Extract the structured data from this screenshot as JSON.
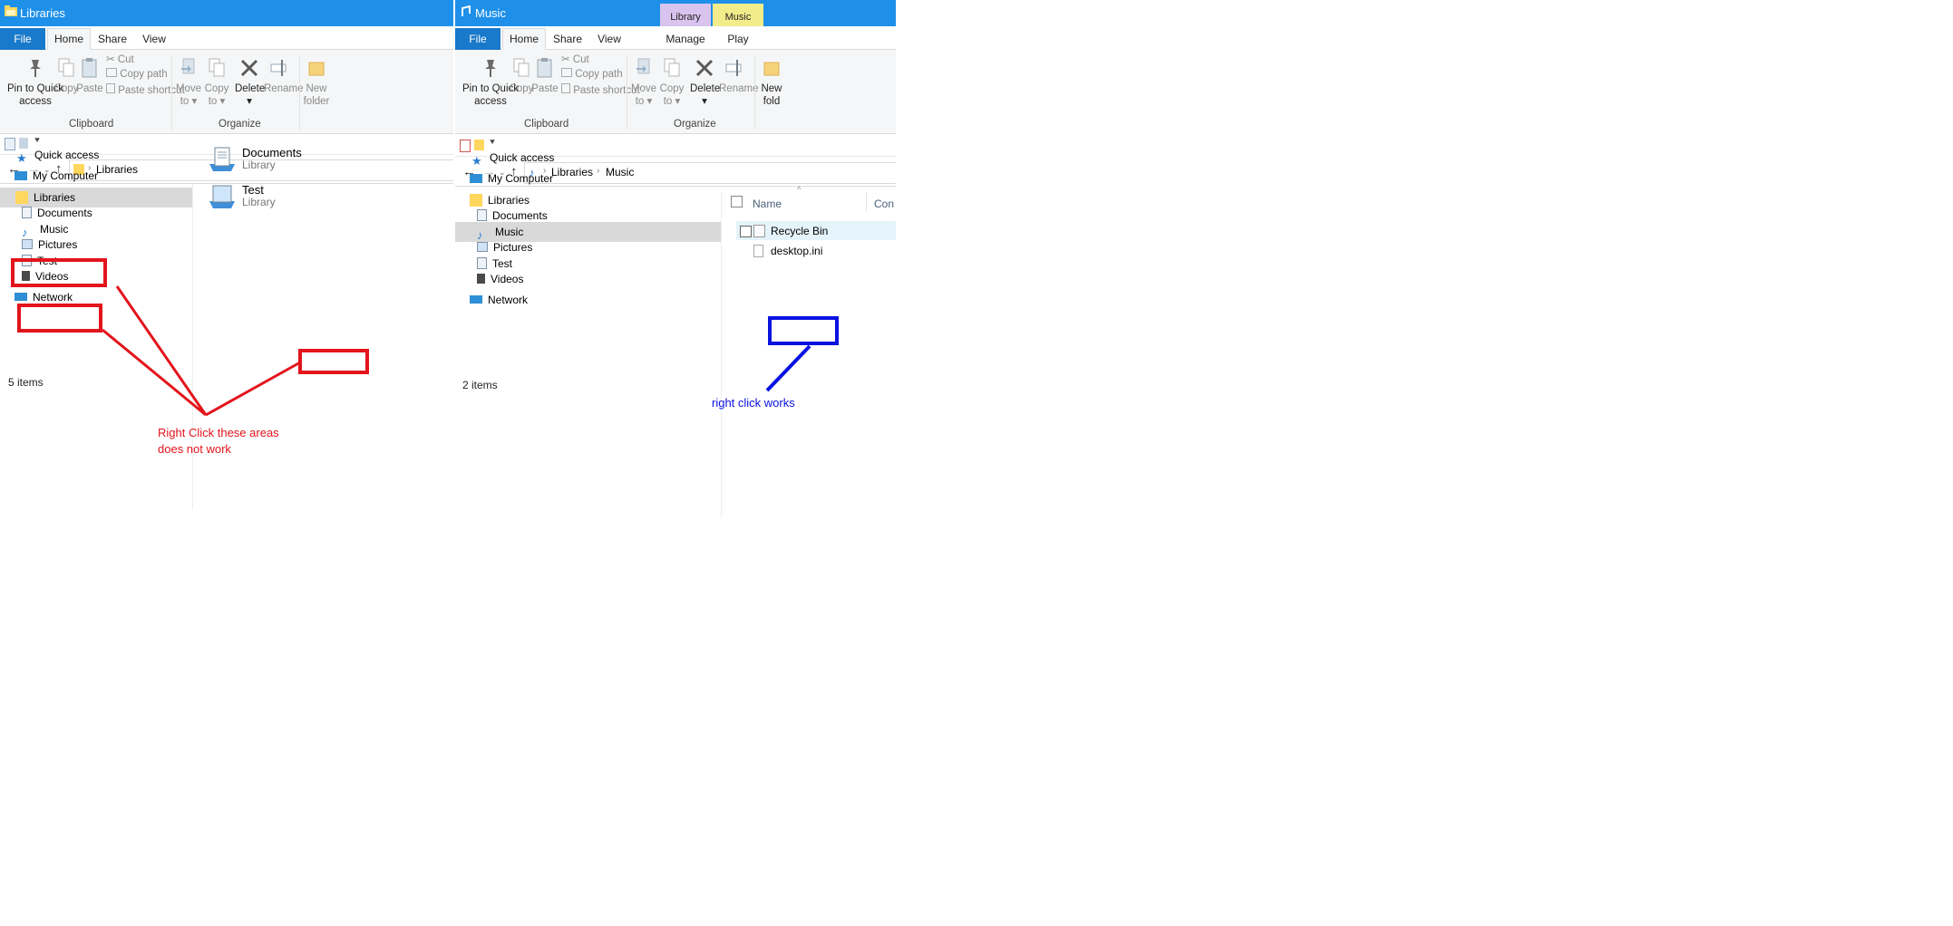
{
  "left": {
    "title": "Libraries",
    "tabs": [
      "File",
      "Home",
      "Share",
      "View"
    ],
    "ribbon": {
      "pin": [
        "Pin to Quick",
        "access"
      ],
      "copy": "Copy",
      "paste": "Paste",
      "cut": "Cut",
      "copy_path": "Copy path",
      "paste_shortcut": "Paste shortcut",
      "move_to": [
        "Move",
        "to ▾"
      ],
      "copy_to": [
        "Copy",
        "to ▾"
      ],
      "delete": "Delete",
      "rename": "Rename",
      "new_folder": [
        "New",
        "folder"
      ],
      "group_clipboard": "Clipboard",
      "group_organize": "Organize"
    },
    "breadcrumb": [
      "Libraries"
    ],
    "nav": [
      "Quick access",
      "My Computer",
      "Libraries",
      "Documents",
      "Music",
      "Pictures",
      "Test",
      "Videos",
      "Network"
    ],
    "tiles": [
      {
        "name": "Documents",
        "type": "Library"
      },
      {
        "name": "Test",
        "type": "Library"
      }
    ],
    "status": "5 items"
  },
  "right": {
    "title": "Music",
    "context_tabs": [
      "Library Tools",
      "Music Tools"
    ],
    "tabs": [
      "File",
      "Home",
      "Share",
      "View",
      "Manage",
      "Play"
    ],
    "ribbon": {
      "pin": [
        "Pin to Quick",
        "access"
      ],
      "copy": "Copy",
      "paste": "Paste",
      "cut": "Cut",
      "copy_path": "Copy path",
      "paste_shortcut": "Paste shortcut",
      "move_to": [
        "Move",
        "to ▾"
      ],
      "copy_to": [
        "Copy",
        "to ▾"
      ],
      "delete": "Delete",
      "rename": "Rename",
      "new_folder": [
        "New",
        "fold"
      ],
      "group_clipboard": "Clipboard",
      "group_organize": "Organize"
    },
    "breadcrumb": [
      "Libraries",
      "Music"
    ],
    "nav": [
      "Quick access",
      "My Computer",
      "Libraries",
      "Documents",
      "Music",
      "Pictures",
      "Test",
      "Videos",
      "Network"
    ],
    "columns": [
      "Name",
      "Con"
    ],
    "files": [
      "Recycle Bin",
      "desktop.ini"
    ],
    "status": "2 items"
  },
  "annotations": {
    "red_text": [
      "Right Click these areas",
      "does not work"
    ],
    "blue_text": "right click works",
    "red_color": "#e3141c",
    "blue_color": "#0a12e0"
  }
}
